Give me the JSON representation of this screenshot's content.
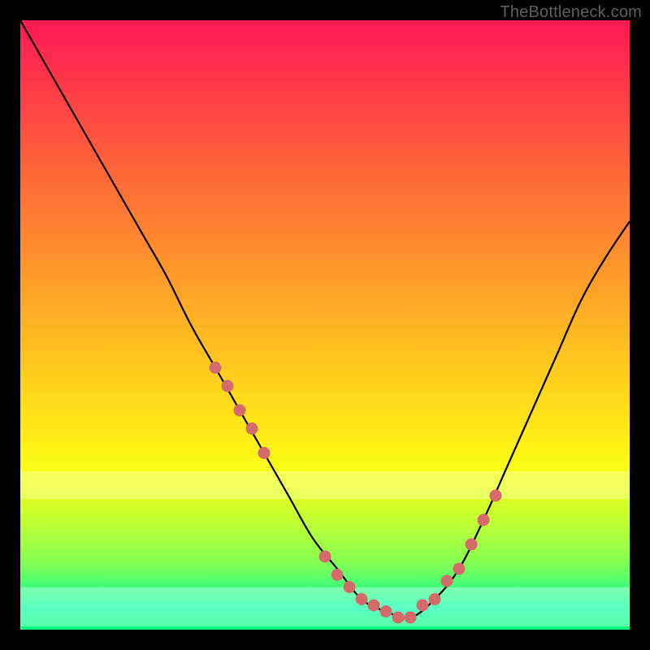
{
  "watermark": "TheBottleneck.com",
  "chart_data": {
    "type": "line",
    "title": "",
    "xlabel": "",
    "ylabel": "",
    "xlim": [
      0,
      100
    ],
    "ylim": [
      0,
      100
    ],
    "series": [
      {
        "name": "bottleneck-curve",
        "x": [
          0,
          4,
          8,
          12,
          16,
          20,
          24,
          28,
          32,
          36,
          40,
          44,
          48,
          52,
          56,
          60,
          64,
          68,
          72,
          76,
          80,
          84,
          88,
          92,
          96,
          100
        ],
        "y": [
          100,
          93,
          86,
          79,
          72,
          65,
          58,
          50,
          43,
          36,
          29,
          22,
          15,
          10,
          5,
          3,
          2,
          5,
          10,
          18,
          27,
          36,
          45,
          54,
          61,
          67
        ]
      }
    ],
    "markers": {
      "name": "highlighted-points",
      "color": "#d46a6a",
      "x": [
        32,
        34,
        36,
        38,
        40,
        50,
        52,
        54,
        56,
        58,
        60,
        62,
        64,
        66,
        68,
        70,
        72,
        74,
        76,
        78
      ],
      "y": [
        43,
        40,
        36,
        33,
        29,
        12,
        9,
        7,
        5,
        4,
        3,
        2,
        2,
        4,
        5,
        8,
        10,
        14,
        18,
        22
      ]
    },
    "gradient_stops": [
      {
        "pos": 0,
        "color": "#ff1953"
      },
      {
        "pos": 0.5,
        "color": "#ffc020"
      },
      {
        "pos": 0.75,
        "color": "#f8ff18"
      },
      {
        "pos": 1.0,
        "color": "#00ff7a"
      }
    ]
  }
}
